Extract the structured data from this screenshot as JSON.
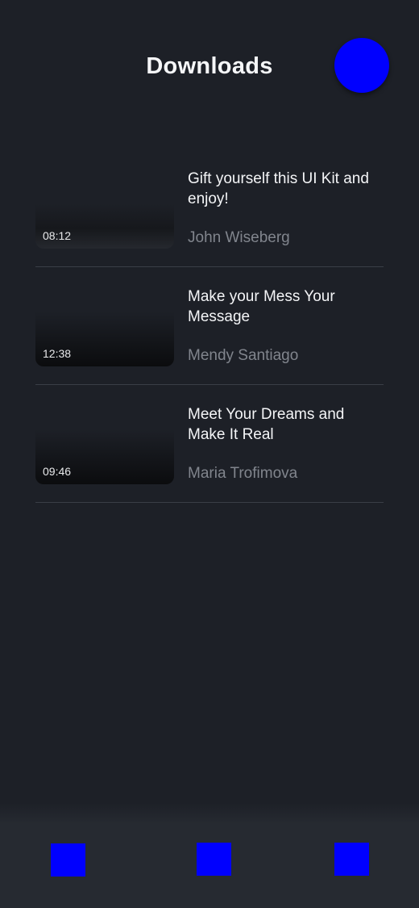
{
  "header": {
    "title": "Downloads"
  },
  "downloads": [
    {
      "duration": "08:12",
      "title": "Gift yourself this UI Kit and enjoy!",
      "author": "John Wiseberg"
    },
    {
      "duration": "12:38",
      "title": "Make your Mess Your Message",
      "author": "Mendy Santiago"
    },
    {
      "duration": "09:46",
      "title": "Meet Your Dreams and Make It Real",
      "author": "Maria Trofimova"
    }
  ],
  "colors": {
    "background": "#1d2027",
    "accent": "#0000ff",
    "divider": "#3a3e46",
    "author_text": "#81858d"
  }
}
